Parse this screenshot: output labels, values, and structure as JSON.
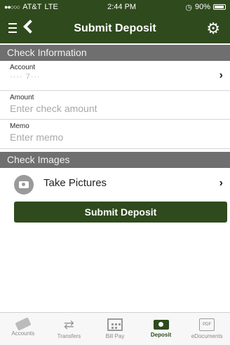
{
  "status_bar": {
    "carrier": "AT&T",
    "network": "LTE",
    "time": "2:44 PM",
    "battery": "90%"
  },
  "nav": {
    "title": "Submit Deposit",
    "icons": [
      "menu-icon",
      "back-icon",
      "gear-icon"
    ]
  },
  "check_info": {
    "header": "Check Information",
    "account": {
      "label": "Account",
      "value": "···· 7···"
    },
    "amount": {
      "label": "Amount",
      "placeholder": "Enter check amount"
    },
    "memo": {
      "label": "Memo",
      "placeholder": "Enter memo"
    }
  },
  "check_images": {
    "header": "Check Images",
    "take_pictures": "Take Pictures"
  },
  "submit_button": "Submit Deposit",
  "tabs": [
    {
      "label": "Accounts",
      "icon": "cards-icon",
      "active": false
    },
    {
      "label": "Transfers",
      "icon": "transfer-arrows-icon",
      "active": false
    },
    {
      "label": "Bill Pay",
      "icon": "calendar-icon",
      "active": false
    },
    {
      "label": "Deposit",
      "icon": "camera-icon",
      "active": true
    },
    {
      "label": "eDocuments",
      "icon": "pdf-document-icon",
      "active": false
    }
  ],
  "colors": {
    "brand": "#2f4a1c",
    "section_header": "#6f6f6f"
  }
}
